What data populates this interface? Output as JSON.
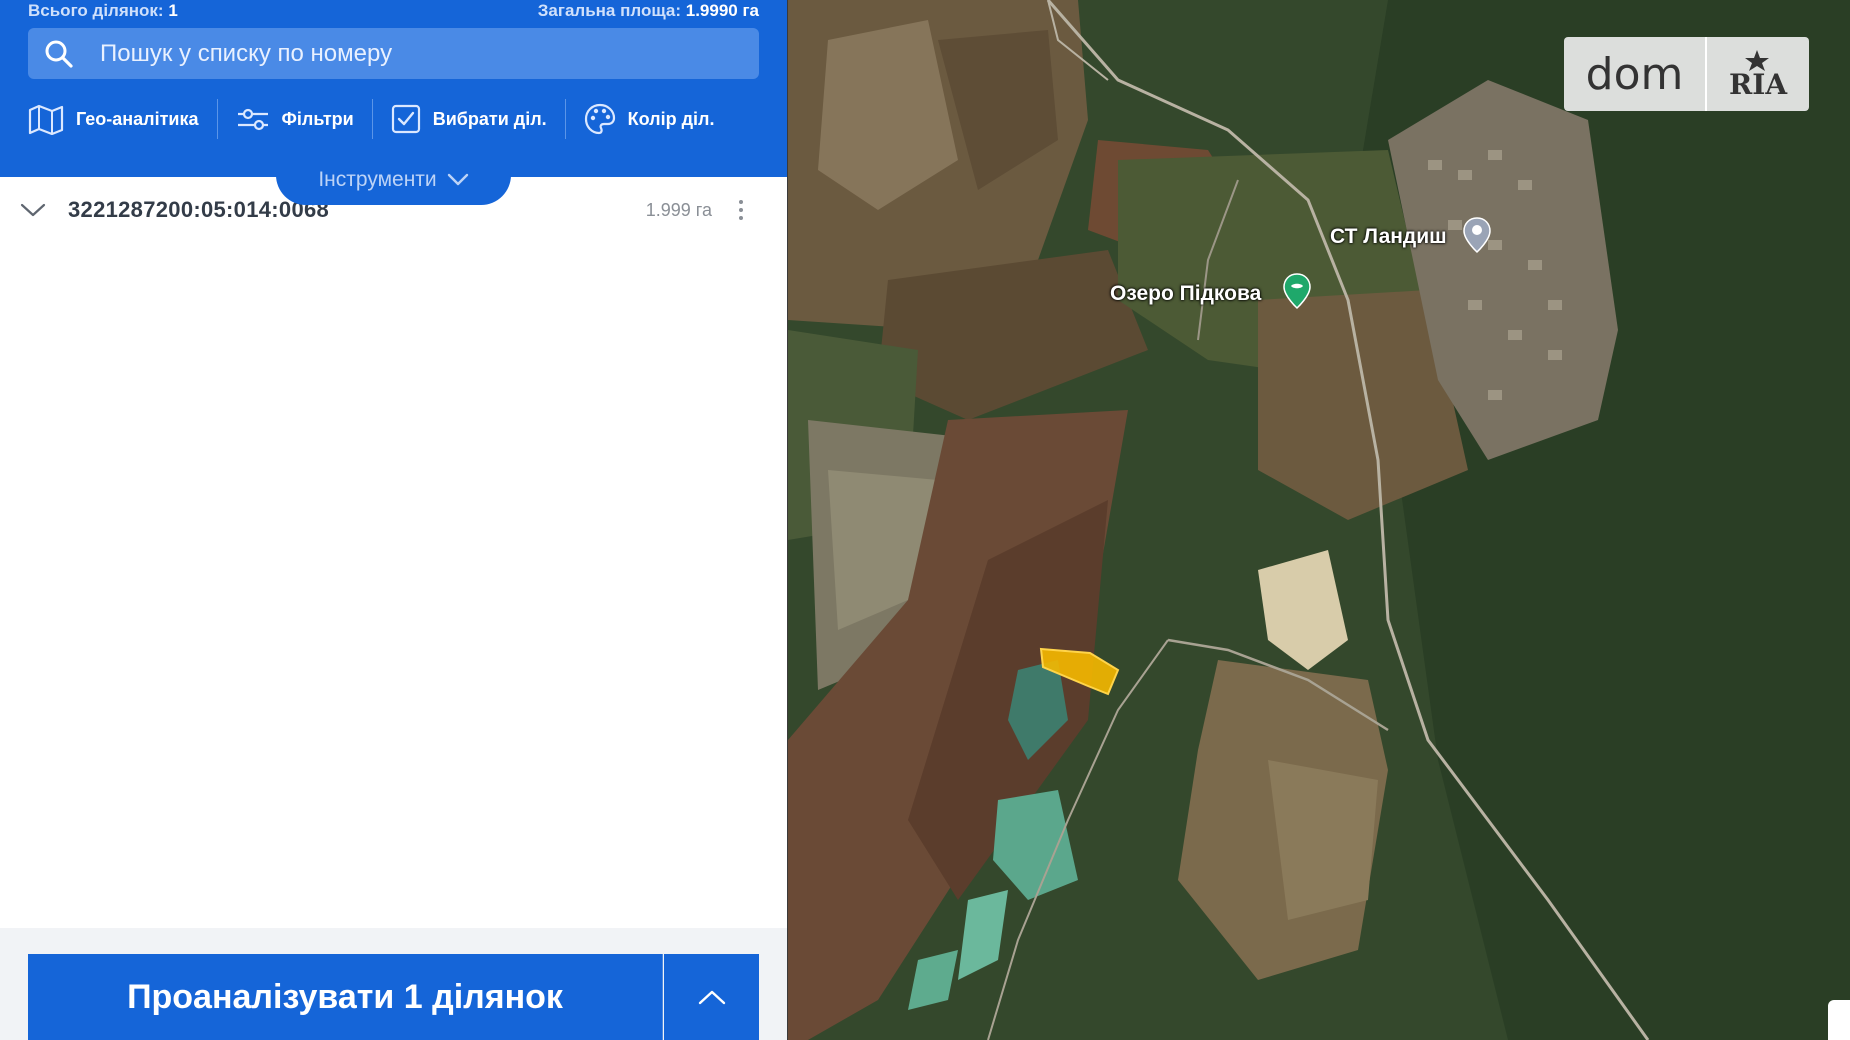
{
  "summary": {
    "total_label": "Всього ділянок:",
    "total_value": "1",
    "area_label": "Загальна площа:",
    "area_value": "1.9990 га"
  },
  "search": {
    "placeholder": "Пошук у списку по номеру",
    "icon": "search-icon"
  },
  "toolbar": {
    "items": [
      {
        "label": "Гео-аналітика",
        "icon": "map-icon"
      },
      {
        "label": "Фільтри",
        "icon": "sliders-icon"
      },
      {
        "label": "Вибрати діл.",
        "icon": "checkbox-icon"
      },
      {
        "label": "Колір діл.",
        "icon": "palette-icon"
      }
    ],
    "tools_tab_label": "Інструменти"
  },
  "parcels": [
    {
      "number": "3221287200:05:014:0068",
      "area": "1.999 га"
    }
  ],
  "footer": {
    "analyze_label": "Проаналізувати 1 ділянок"
  },
  "map": {
    "labels": {
      "settlement": "СТ Ландиш",
      "lake": "Озеро Підкова"
    },
    "parcel_highlight_color": "#f5b800"
  },
  "logo": {
    "left": "dom",
    "right": "RIA"
  },
  "colors": {
    "brand_blue": "#1565d8",
    "search_bg": "#4a8ae6"
  }
}
